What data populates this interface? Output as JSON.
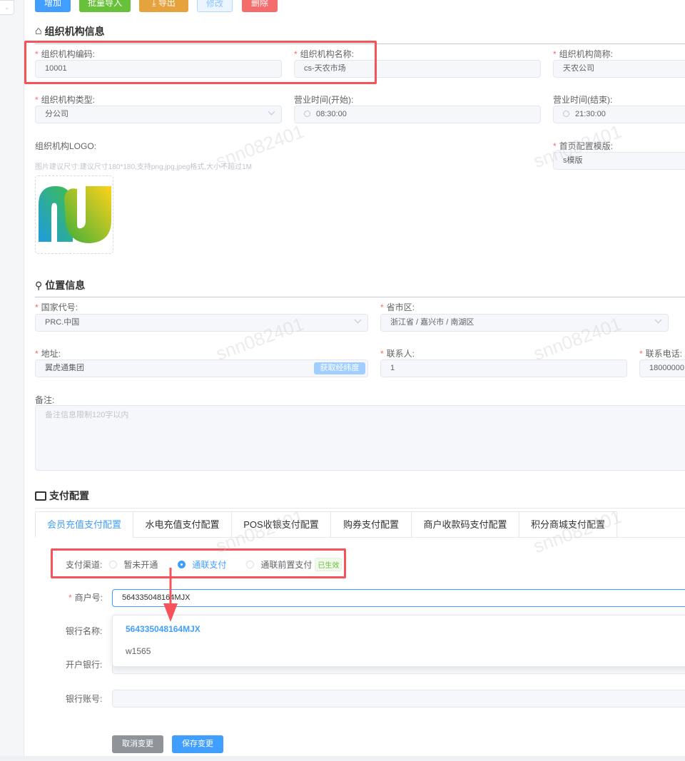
{
  "toolbar": {
    "add": "增加",
    "import": "批量导入",
    "export": "导出",
    "edit": "修改",
    "delete": "删除"
  },
  "org": {
    "title": "组织机构信息",
    "code_label": "组织机构编码:",
    "code": "10001",
    "name_label": "组织机构名称:",
    "name": "cs-天农市场",
    "short_label": "组织机构简称:",
    "short": "天农公司",
    "type_label": "组织机构类型:",
    "type": "分公司",
    "open_label": "营业时间(开始):",
    "open": "08:30:00",
    "close_label": "营业时间(结束):",
    "close": "21:30:00",
    "logo_label": "组织机构LOGO:",
    "logo_hint": "图片建议尺寸:建议尺寸180*180,支持png,jpg,jpeg格式,大小不超过1M",
    "template_label": "首页配置模版:",
    "template": "s模版"
  },
  "location": {
    "title": "位置信息",
    "country_label": "国家代号:",
    "country": "PRC.中国",
    "region_label": "省市区:",
    "region": "浙江省 / 嘉兴市 / 南湖区",
    "address_label": "地址:",
    "address": "翼虎通集团",
    "geo_button": "获取经纬度",
    "contact_label": "联系人:",
    "contact": "1",
    "phone_label": "联系电话:",
    "phone": "18000000",
    "remark_label": "备注:",
    "remark_placeholder": "备注信息限制120字以内"
  },
  "payment": {
    "title": "支付配置",
    "tabs": [
      "会员充值支付配置",
      "水电充值支付配置",
      "POS收银支付配置",
      "购券支付配置",
      "商户收款码支付配置",
      "积分商城支付配置"
    ],
    "channel_label": "支付渠道:",
    "options": [
      "暂未开通",
      "通联支付",
      "通联前置支付"
    ],
    "selected": "通联支付",
    "badge": "已生效",
    "merchant_label": "商户号:",
    "merchant": "564335048164MJX",
    "suggestions": [
      "564335048164MJX",
      "w1565"
    ],
    "bank_name_label": "银行名称:",
    "open_bank_label": "开户银行:",
    "account_label": "银行账号:",
    "cancel": "取消变更",
    "save": "保存变更"
  },
  "watermark": "snn082401",
  "colors": {
    "primary": "#409eff",
    "success": "#67c23a",
    "warning": "#e6a23c",
    "danger": "#f56c6c",
    "annotation": "#f5525a"
  }
}
